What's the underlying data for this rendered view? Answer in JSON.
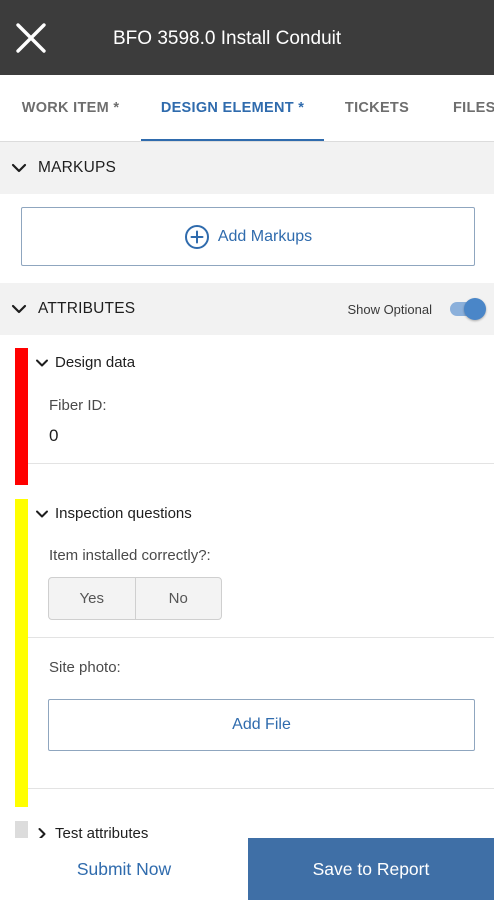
{
  "app_bar": {
    "title": "BFO 3598.0 Install Conduit",
    "close_icon": "close-icon"
  },
  "tabs": [
    {
      "label": "WORK ITEM *",
      "active": false
    },
    {
      "label": "DESIGN ELEMENT *",
      "active": true
    },
    {
      "label": "TICKETS",
      "active": false
    },
    {
      "label": "FILES",
      "active": false
    }
  ],
  "markups": {
    "header": "MARKUPS",
    "add_button": "Add Markups",
    "add_icon": "plus-circle-icon"
  },
  "attributes": {
    "header": "ATTRIBUTES",
    "show_optional_label": "Show Optional",
    "show_optional_on": true,
    "groups": [
      {
        "title": "Design data",
        "status_color": "#ff0000",
        "fields": [
          {
            "label": "Fiber ID:",
            "value": "0"
          }
        ]
      },
      {
        "title": "Inspection questions",
        "status_color": "#ffff00",
        "installed_label": "Item installed correctly?:",
        "yes": "Yes",
        "no": "No",
        "photo_label": "Site photo:",
        "add_file": "Add File"
      },
      {
        "title": "Test attributes",
        "status_color": "#dcdcdc"
      }
    ]
  },
  "footer": {
    "submit": "Submit Now",
    "save": "Save to Report"
  },
  "colors": {
    "accent": "#2f6bad",
    "app_bar": "#3c3c3c",
    "save_button": "#3f6fa6"
  }
}
